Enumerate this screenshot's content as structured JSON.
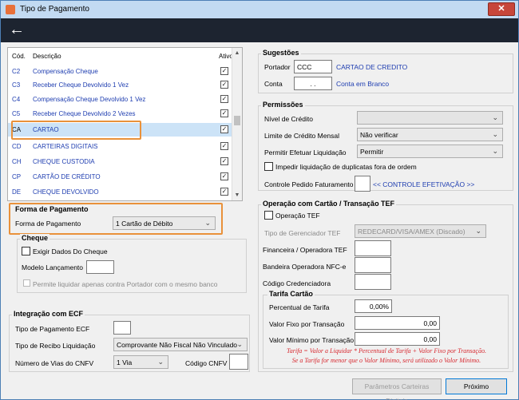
{
  "window": {
    "title": "Tipo de Pagamento",
    "close_label": "✕",
    "back_label": "←"
  },
  "list": {
    "headers": {
      "cod": "Cód.",
      "desc": "Descrição",
      "ativo": "Ativo"
    },
    "rows": [
      {
        "cod": "",
        "desc": "",
        "checked": ""
      },
      {
        "cod": "C2",
        "desc": "Compensação Cheque",
        "checked": "✓"
      },
      {
        "cod": "C3",
        "desc": "Receber Cheque Devolvido 1 Vez",
        "checked": "✓"
      },
      {
        "cod": "C4",
        "desc": "Compensação Cheque Devolvido 1 Vez",
        "checked": "✓"
      },
      {
        "cod": "C5",
        "desc": "Receber Cheque Devolvido 2 Vezes",
        "checked": "✓"
      },
      {
        "cod": "CA",
        "desc": "CARTAO",
        "checked": "✓"
      },
      {
        "cod": "CD",
        "desc": "CARTEIRAS DIGITAIS",
        "checked": "✓"
      },
      {
        "cod": "CH",
        "desc": "CHEQUE CUSTODIA",
        "checked": "✓"
      },
      {
        "cod": "CP",
        "desc": "CARTÃO DE CRÉDITO",
        "checked": "✓"
      },
      {
        "cod": "DE",
        "desc": "CHEQUE DEVOLVIDO",
        "checked": "✓"
      }
    ],
    "selected_index": 5
  },
  "forma_pagamento": {
    "title": "Forma de Pagamento",
    "label": "Forma de Pagamento",
    "value": "1 Cartão de Débito"
  },
  "cheque": {
    "title": "Cheque",
    "exigir_label": "Exigir Dados Do Cheque",
    "modelo_label": "Modelo Lançamento",
    "modelo_value": "",
    "permite_label": "Permite liquidar apenas contra Portador com o mesmo banco"
  },
  "integracao_ecf": {
    "title": "Integração com ECF",
    "tipo_label": "Tipo de Pagamento ECF",
    "tipo_value": "",
    "recibo_label": "Tipo de Recibo Liquidação",
    "recibo_value": "Comprovante Não Fiscal Não Vinculado",
    "vias_label": "Número de Vias do CNFV",
    "vias_value": "1 Via",
    "codigo_label": "Código CNFV",
    "codigo_value": ""
  },
  "sugestoes": {
    "title": "Sugestões",
    "portador_label": "Portador",
    "portador_value": "CCC",
    "portador_desc": "CARTAO DE CREDITO",
    "conta_label": "Conta",
    "conta_value": ". .",
    "conta_desc": "Conta em Branco"
  },
  "permissoes": {
    "title": "Permissões",
    "nivel_label": "Nível de Crédito",
    "nivel_value": "",
    "limite_label": "Limite de Crédito Mensal",
    "limite_value": "Não verificar",
    "efetuar_label": "Permitir Efetuar Liquidação",
    "efetuar_value": "Permitir",
    "impedir_label": "Impedir liquidação de duplicatas fora de ordem",
    "controle_label": "Controle Pedido Faturamento",
    "controle_value": "",
    "controle_link": "<< CONTROLE EFETIVAÇÃO >>"
  },
  "tef": {
    "title": "Operação com Cartão / Transação TEF",
    "operacao_label": "Operação TEF",
    "gerenciador_label": "Tipo de Gerenciador TEF",
    "gerenciador_value": "REDECARD/VISA/AMEX (Discado)",
    "financeira_label": "Financeira / Operadora TEF",
    "financeira_value": "",
    "bandeira_label": "Bandeira Operadora NFC-e",
    "bandeira_value": "",
    "credenciadora_label": "Código Credenciadora",
    "credenciadora_value": ""
  },
  "tarifa": {
    "title": "Tarifa Cartão",
    "percentual_label": "Percentual de Tarifa",
    "percentual_value": "0,00%",
    "fixo_label": "Valor Fixo por Transação",
    "fixo_value": "0,00",
    "minimo_label": "Valor Mínimo por Transação",
    "minimo_value": "0,00",
    "note_line1": "Tarifa = Valor a Liquidar * Percentual de Tarifa + Valor Fixo por Transação.",
    "note_line2": "Se a Tarifa for menor que o Valor Mínimo, será utilizado o Valor Mínimo."
  },
  "buttons": {
    "parametros": "Parâmetros Carteiras Digitais",
    "proximo": "Próximo"
  },
  "colors": {
    "accent_highlight": "#e9913a",
    "link_blue": "#1e3db0",
    "note_red": "#d7282f"
  }
}
